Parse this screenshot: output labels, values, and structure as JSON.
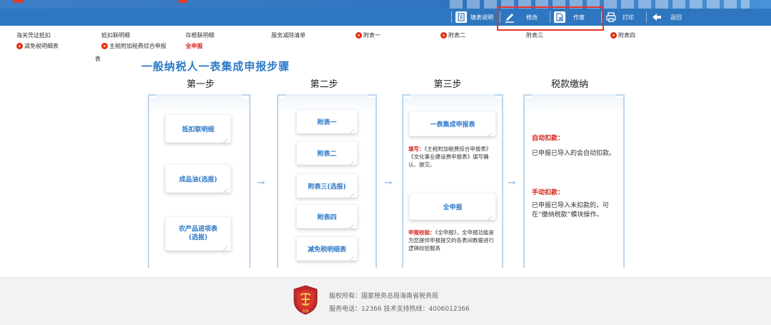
{
  "toolbar": {
    "fill_help": "填表说明",
    "modify": "修改",
    "void": "作废",
    "print": "打印",
    "back": "返回"
  },
  "tabs": {
    "row1": [
      "海关凭证抵扣",
      "抵扣联明细",
      "存根联明细",
      "服务减除清单",
      "附表一",
      "附表二",
      "附表三",
      "附表四"
    ],
    "row2": [
      "减免税明细表",
      "主税附加税费综合申报",
      "全申报"
    ],
    "stray": "表"
  },
  "main": {
    "title": "一般纳税人一表集成申报步骤",
    "step1": "第一步",
    "step2": "第二步",
    "step3": "第三步",
    "step4": "税款缴纳",
    "step1_cards": [
      "抵扣联明细",
      "成品油(选报)",
      "农产品进项表\n(选报)"
    ],
    "step2_cards": [
      "附表一",
      "附表二",
      "附表三(选报)",
      "附表四",
      "减免税明细表"
    ],
    "step3_card1": "一表集成申报表",
    "step3_desc1_lead": "填写：",
    "step3_desc1": "《主税附加税费综合申报表》《文化事业建设费申报表》填写确认、提交。",
    "step3_card2": "全申报",
    "step3_desc2_lead": "申报校验：",
    "step3_desc2": "《全申报》，全申报功能是为您提供申报提交的各表间数据进行逻辑校验服务",
    "auto_title": "自动扣款：",
    "auto_text": "已申报已导入的会自动扣款。",
    "manual_title": "手动扣款：",
    "manual_text": "已申报已导入未扣款的，可在“缴纳税款”模块操作。"
  },
  "footer": {
    "logo_text": "税徽",
    "copyright": "版权所有：国家税务总局海南省税务局",
    "service": "服务电话：12366  技术支持热线：4006012366"
  },
  "colors": {
    "toolbar": "#2e76bf",
    "accent": "#2c79c8",
    "red": "#d6241a",
    "highlight": "#e8322a"
  },
  "icons": {
    "fill_help": "document-list-icon",
    "modify": "pencil-icon",
    "void": "document-cancel-icon",
    "print": "printer-icon",
    "back": "back-arrow-icon"
  }
}
